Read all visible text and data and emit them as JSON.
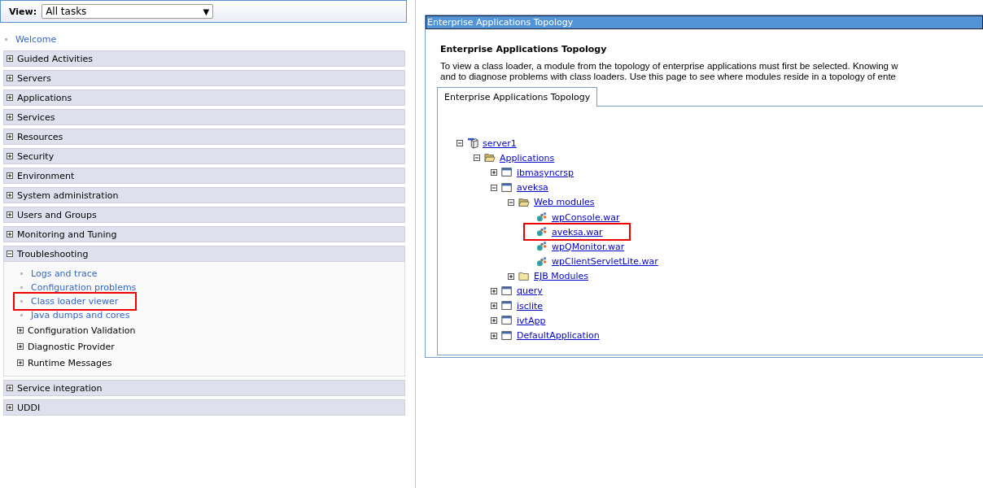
{
  "view_selector": {
    "label": "View:",
    "value": "All tasks",
    "arrow": "▼"
  },
  "navigation": {
    "top_link": "Welcome",
    "sections": [
      {
        "label": "Guided Activities",
        "expanded": false
      },
      {
        "label": "Servers",
        "expanded": false
      },
      {
        "label": "Applications",
        "expanded": false
      },
      {
        "label": "Services",
        "expanded": false
      },
      {
        "label": "Resources",
        "expanded": false
      },
      {
        "label": "Security",
        "expanded": false
      },
      {
        "label": "Environment",
        "expanded": false
      },
      {
        "label": "System administration",
        "expanded": false
      },
      {
        "label": "Users and Groups",
        "expanded": false
      },
      {
        "label": "Monitoring and Tuning",
        "expanded": false
      },
      {
        "label": "Troubleshooting",
        "expanded": true,
        "children": [
          {
            "kind": "link",
            "label": "Logs and trace",
            "highlighted": false
          },
          {
            "kind": "link",
            "label": "Configuration problems",
            "highlighted": false
          },
          {
            "kind": "link",
            "label": "Class loader viewer",
            "highlighted": true
          },
          {
            "kind": "link",
            "label": "Java dumps and cores",
            "highlighted": false
          },
          {
            "kind": "group",
            "label": "Configuration Validation",
            "expanded": false
          },
          {
            "kind": "group",
            "label": "Diagnostic Provider",
            "expanded": false
          },
          {
            "kind": "group",
            "label": "Runtime Messages",
            "expanded": false
          }
        ]
      },
      {
        "label": "Service integration",
        "expanded": false
      },
      {
        "label": "UDDI",
        "expanded": false
      }
    ]
  },
  "portlet": {
    "title": "Enterprise Applications Topology",
    "heading": "Enterprise Applications Topology",
    "description": [
      "To view a class loader, a module from the topology of enterprise applications must first be selected. Knowing w",
      "and to diagnose problems with class loaders. Use this page to see where modules reside in a topology of ente"
    ],
    "tabs": [
      {
        "label": "Enterprise Applications Topology",
        "selected": true
      }
    ],
    "tree": [
      {
        "kind": "server",
        "label": "server1",
        "expanded": true,
        "highlighted": false,
        "children": [
          {
            "kind": "folder",
            "label": "Applications",
            "expanded": true,
            "highlighted": false,
            "children": [
              {
                "kind": "app",
                "label": "ibmasyncrsp",
                "expanded": false,
                "highlighted": false
              },
              {
                "kind": "app",
                "label": "aveksa",
                "expanded": true,
                "highlighted": false,
                "children": [
                  {
                    "kind": "folder",
                    "label": "Web modules",
                    "expanded": true,
                    "highlighted": false,
                    "children": [
                      {
                        "kind": "module",
                        "label": "wpConsole.war",
                        "highlighted": false
                      },
                      {
                        "kind": "module",
                        "label": "aveksa.war",
                        "highlighted": true
                      },
                      {
                        "kind": "module",
                        "label": "wpQMonitor.war",
                        "highlighted": false
                      },
                      {
                        "kind": "module",
                        "label": "wpClientServletLite.war",
                        "highlighted": false
                      }
                    ]
                  },
                  {
                    "kind": "closedfolder",
                    "label": "EJB Modules",
                    "expanded": false,
                    "highlighted": false
                  }
                ]
              },
              {
                "kind": "app",
                "label": "query",
                "expanded": false,
                "highlighted": false
              },
              {
                "kind": "app",
                "label": "isclite",
                "expanded": false,
                "highlighted": false
              },
              {
                "kind": "app",
                "label": "ivtApp",
                "expanded": false,
                "highlighted": false
              },
              {
                "kind": "app",
                "label": "DefaultApplication",
                "expanded": false,
                "highlighted": false
              }
            ]
          }
        ]
      }
    ]
  }
}
